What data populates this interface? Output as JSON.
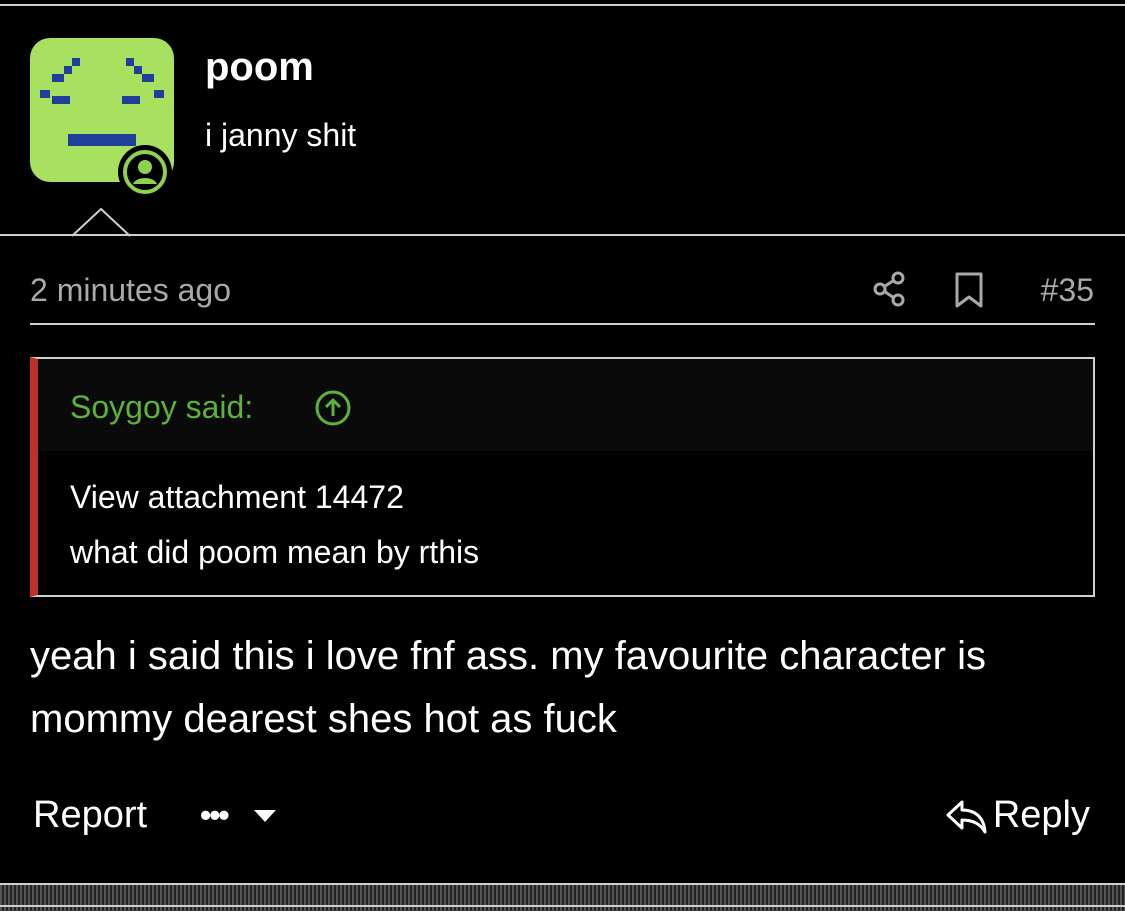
{
  "colors": {
    "background": "#000000",
    "avatar_bg": "#a8e15f",
    "avatar_pixels": "#1f3f9a",
    "online_badge": "#8fd14f",
    "quote_border": "#c0302b",
    "quote_author": "#5bb33a",
    "muted_text": "#a9a9a9"
  },
  "user": {
    "name": "poom",
    "title": "i janny shit",
    "online_badge_icon": "user-circle-icon"
  },
  "post": {
    "time": "2 minutes ago",
    "number": "#35",
    "share_icon": "share-icon",
    "bookmark_icon": "bookmark-icon",
    "quote": {
      "author": "Soygoy said:",
      "jump_icon": "arrow-up-circle-icon",
      "line1": "View attachment 14472",
      "line2": "what did poom mean by rthis"
    },
    "body": "yeah i said this i love fnf ass. my favourite character is mommy dearest shes hot as fuck"
  },
  "actions": {
    "report": "Report",
    "more": "•••",
    "reply": "Reply"
  }
}
